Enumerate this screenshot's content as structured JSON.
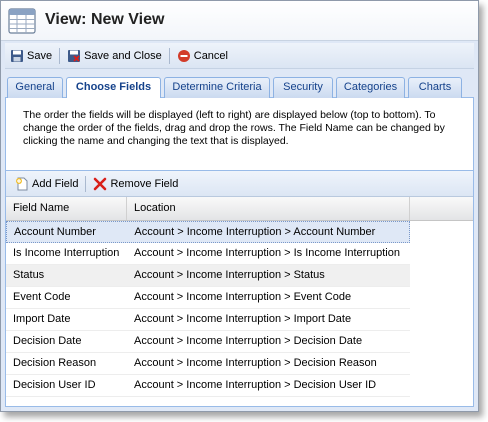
{
  "window": {
    "title": "View: New View"
  },
  "toolbar": {
    "save": "Save",
    "save_close": "Save and Close",
    "cancel": "Cancel"
  },
  "tabs": [
    {
      "label": "General"
    },
    {
      "label": "Choose Fields",
      "active": true
    },
    {
      "label": "Determine Criteria"
    },
    {
      "label": "Security"
    },
    {
      "label": "Categories"
    },
    {
      "label": "Charts"
    }
  ],
  "description": "The order the fields will be displayed (left to right) are displayed below (top to bottom). To change the order of the fields, drag and drop the rows. The Field Name can be changed by clicking the name and changing the text that is displayed.",
  "grid_toolbar": {
    "add_field": "Add Field",
    "remove_field": "Remove Field"
  },
  "grid": {
    "columns": [
      "Field Name",
      "Location"
    ],
    "rows": [
      {
        "field": "Account Number",
        "location": "Account > Income Interruption > Account Number"
      },
      {
        "field": "Is Income Interruption",
        "location": "Account > Income Interruption > Is Income Interruption"
      },
      {
        "field": "Status",
        "location": "Account > Income Interruption > Status"
      },
      {
        "field": "Event Code",
        "location": "Account > Income Interruption > Event Code"
      },
      {
        "field": "Import Date",
        "location": "Account > Income Interruption > Import Date"
      },
      {
        "field": "Decision Date",
        "location": "Account > Income Interruption > Decision Date"
      },
      {
        "field": "Decision Reason",
        "location": "Account > Income Interruption > Decision Reason"
      },
      {
        "field": "Decision User ID",
        "location": "Account > Income Interruption > Decision User ID"
      }
    ]
  },
  "icons": {
    "app": "view-table-icon",
    "save": "floppy-disk-icon",
    "save_close": "floppy-disk-close-icon",
    "cancel": "cancel-circle-icon",
    "add": "add-document-icon",
    "remove": "red-x-icon"
  },
  "colors": {
    "tab_text": "#15428b",
    "border": "#99bbe8",
    "cancel": "#d23c2a",
    "remove": "#d9201a"
  }
}
